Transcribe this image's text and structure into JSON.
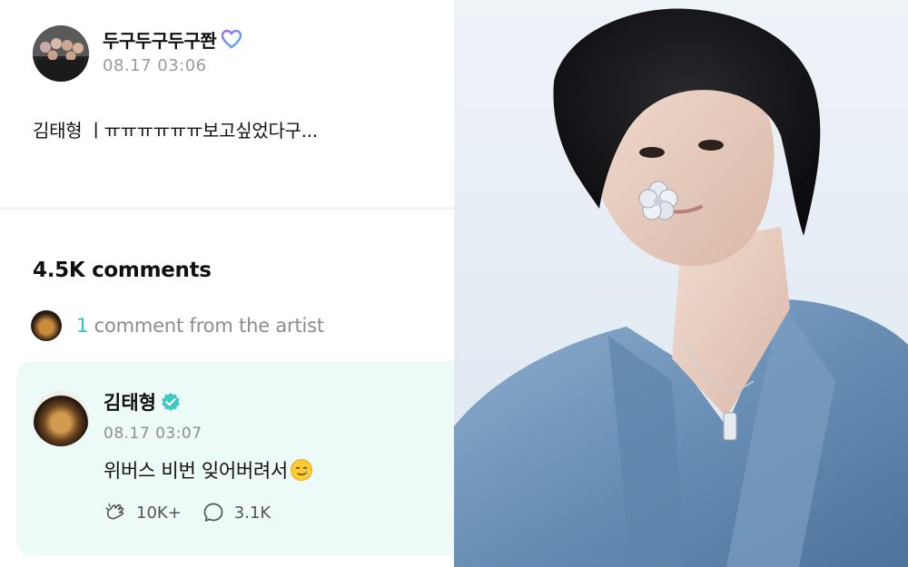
{
  "post": {
    "author": "두구두구두구쫜",
    "timestamp": "08.17 03:06",
    "body": "김태형 ㅣㅠㅠㅠㅠㅠㅠ보고싶었다구..."
  },
  "comments": {
    "count_label": "4.5K comments",
    "artist_count": "1",
    "artist_label": "comment from the artist"
  },
  "artist_comment": {
    "author": "김태형",
    "timestamp": "08.17 03:07",
    "text": "위버스 비번 잊어버려서",
    "likes": "10K+",
    "replies": "3.1K"
  },
  "icons": {
    "author_badge": "heart-icon",
    "artist_badge": "verified-icon",
    "emoji": "sad-smile-emoji",
    "like": "cheer-hand-icon",
    "reply": "speech-bubble-icon"
  },
  "colors": {
    "accent": "#2fc4c0",
    "card_bg": "#ecfaf8",
    "muted": "#8c8c8c"
  }
}
